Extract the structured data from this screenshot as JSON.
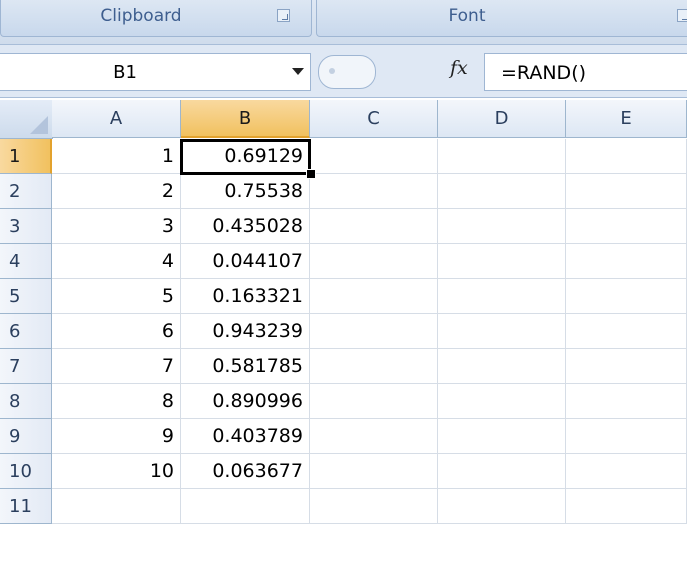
{
  "ribbon": {
    "groups": [
      {
        "label": "Clipboard"
      },
      {
        "label": "Font"
      }
    ]
  },
  "formula_bar": {
    "name_box": "B1",
    "fx_icon": "fx",
    "formula": "=RAND()"
  },
  "sheet": {
    "columns": [
      "A",
      "B",
      "C",
      "D",
      "E"
    ],
    "active_column": "B",
    "active_row": "1",
    "rows": [
      {
        "header": "1",
        "a": "1",
        "b": "0.69129"
      },
      {
        "header": "2",
        "a": "2",
        "b": "0.75538"
      },
      {
        "header": "3",
        "a": "3",
        "b": "0.435028"
      },
      {
        "header": "4",
        "a": "4",
        "b": "0.044107"
      },
      {
        "header": "5",
        "a": "5",
        "b": "0.163321"
      },
      {
        "header": "6",
        "a": "6",
        "b": "0.943239"
      },
      {
        "header": "7",
        "a": "7",
        "b": "0.581785"
      },
      {
        "header": "8",
        "a": "8",
        "b": "0.890996"
      },
      {
        "header": "9",
        "a": "9",
        "b": "0.403789"
      },
      {
        "header": "10",
        "a": "10",
        "b": "0.063677"
      },
      {
        "header": "11",
        "a": "",
        "b": ""
      }
    ]
  },
  "colors": {
    "ribbon_bg": "#dfe8f4",
    "header_text": "#2b3f5e",
    "active_header": "#f1c15f",
    "grid_line": "#d6dde6"
  }
}
